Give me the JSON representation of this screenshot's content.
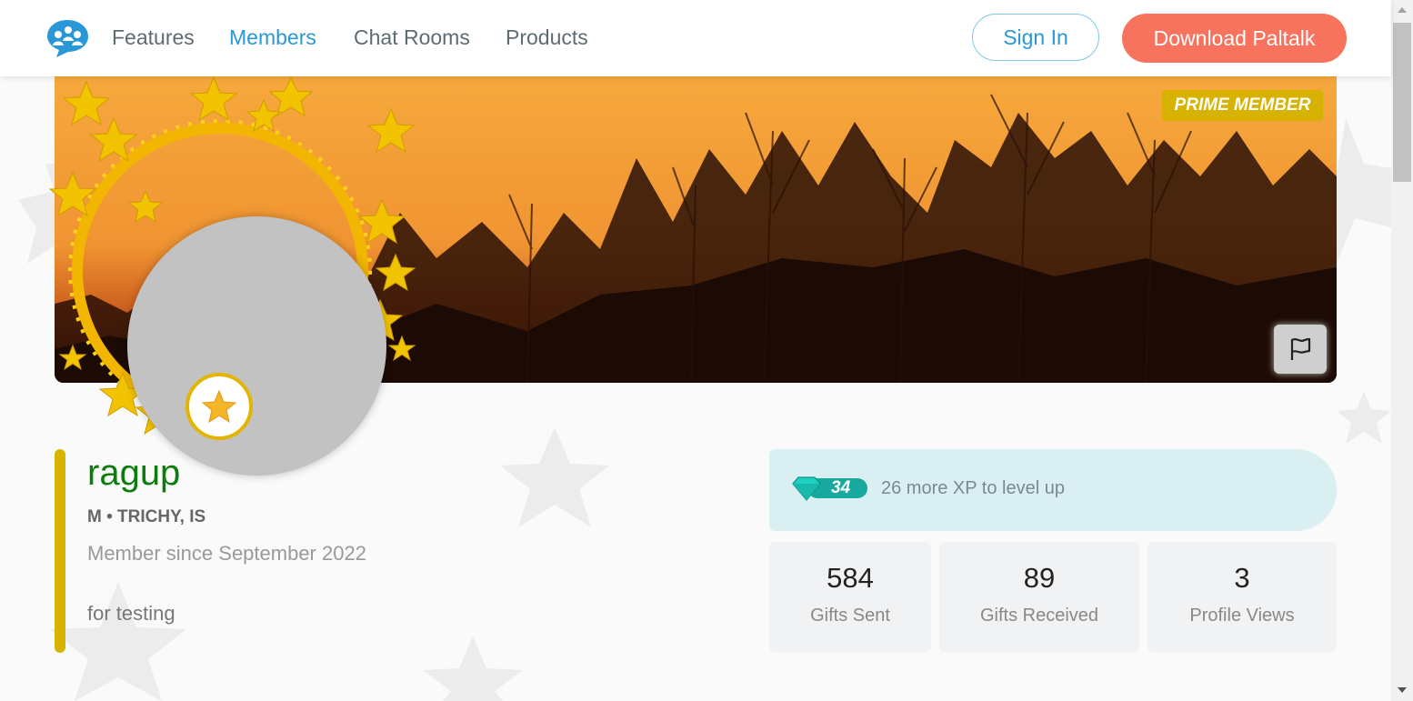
{
  "nav": {
    "links": [
      "Features",
      "Members",
      "Chat Rooms",
      "Products"
    ],
    "active": "Members",
    "sign_in": "Sign In",
    "download": "Download Paltalk"
  },
  "banner": {
    "badge": "PRIME MEMBER"
  },
  "profile": {
    "username": "ragup",
    "meta": "M • TRICHY, IS",
    "member_since": "Member since September 2022",
    "bio": "for testing"
  },
  "xp": {
    "level": "34",
    "text": "26 more XP to level up"
  },
  "stats": [
    {
      "value": "584",
      "label": "Gifts Sent"
    },
    {
      "value": "89",
      "label": "Gifts Received"
    },
    {
      "value": "3",
      "label": "Profile Views"
    }
  ],
  "colors": {
    "brand_blue": "#2a97d6",
    "download_button": "#f7735d",
    "prime_gold": "#d7b200",
    "username_green": "#0c7d0c",
    "xp_teal": "#17b0a8"
  }
}
